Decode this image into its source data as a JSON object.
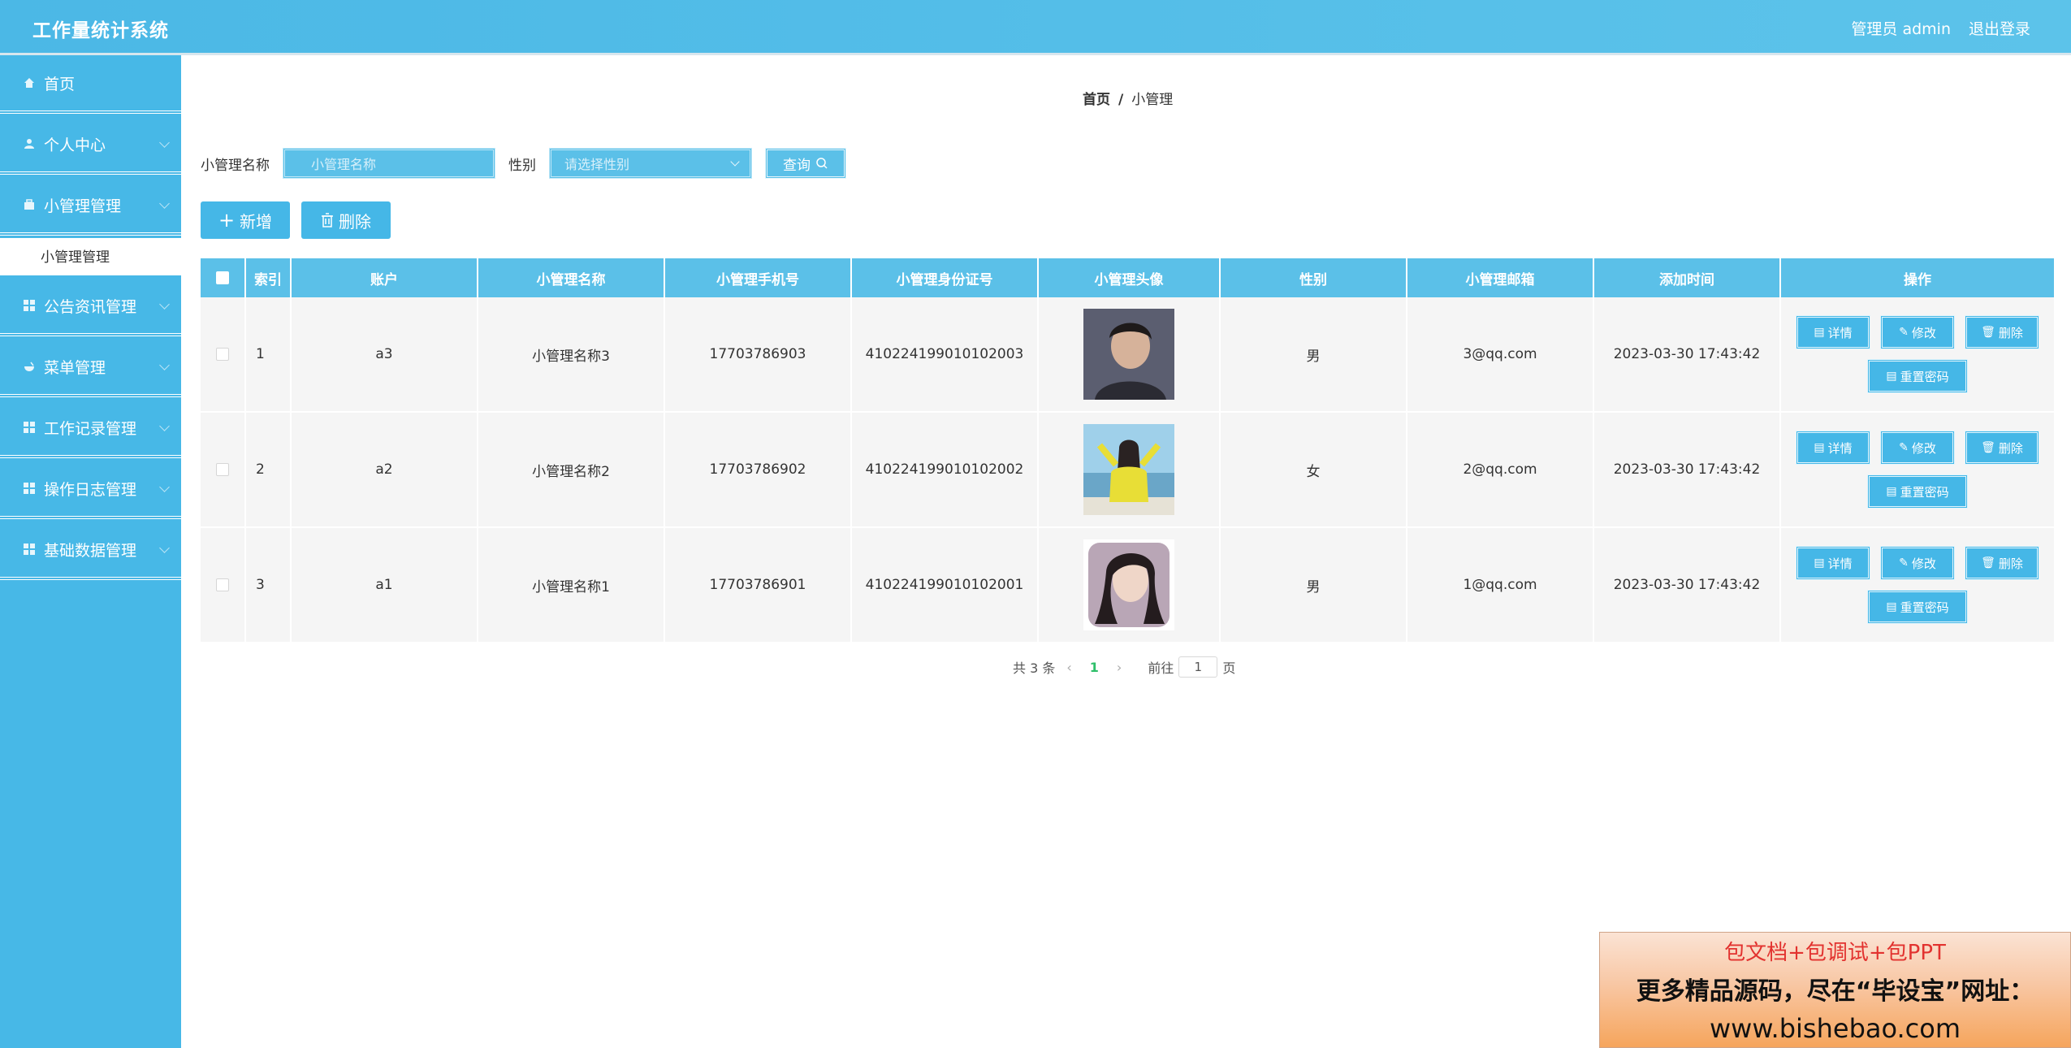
{
  "header": {
    "app_title": "工作量统计系统",
    "admin_label": "管理员 admin",
    "logout_label": "退出登录"
  },
  "sidebar": {
    "items": [
      {
        "label": "首页",
        "icon": "home-icon"
      },
      {
        "label": "个人中心",
        "icon": "user-icon"
      },
      {
        "label": "小管理管理",
        "icon": "briefcase-icon"
      },
      {
        "label": "公告资讯管理",
        "icon": "grid-icon"
      },
      {
        "label": "菜单管理",
        "icon": "bowl-icon"
      },
      {
        "label": "工作记录管理",
        "icon": "grid-icon"
      },
      {
        "label": "操作日志管理",
        "icon": "grid-icon"
      },
      {
        "label": "基础数据管理",
        "icon": "grid-icon"
      }
    ],
    "sub_item": "小管理管理"
  },
  "breadcrumb": {
    "home": "首页",
    "separator": "/",
    "current": "小管理"
  },
  "search": {
    "name_label": "小管理名称",
    "name_placeholder": "小管理名称",
    "gender_label": "性别",
    "gender_placeholder": "请选择性别",
    "query_label": "查询"
  },
  "actions": {
    "add_label": "新增",
    "delete_label": "删除"
  },
  "table": {
    "headers": [
      "索引",
      "账户",
      "小管理名称",
      "小管理手机号",
      "小管理身份证号",
      "小管理头像",
      "性别",
      "小管理邮箱",
      "添加时间",
      "操作"
    ],
    "rows": [
      {
        "index": "1",
        "account": "a3",
        "name": "小管理名称3",
        "phone": "17703786903",
        "id_card": "410224199010102003",
        "gender": "男",
        "email": "3@qq.com",
        "time": "2023-03-30 17:43:42"
      },
      {
        "index": "2",
        "account": "a2",
        "name": "小管理名称2",
        "phone": "17703786902",
        "id_card": "410224199010102002",
        "gender": "女",
        "email": "2@qq.com",
        "time": "2023-03-30 17:43:42"
      },
      {
        "index": "3",
        "account": "a1",
        "name": "小管理名称1",
        "phone": "17703786901",
        "id_card": "410224199010102001",
        "gender": "男",
        "email": "1@qq.com",
        "time": "2023-03-30 17:43:42"
      }
    ],
    "op_labels": {
      "detail": "详情",
      "edit": "修改",
      "delete": "删除",
      "reset": "重置密码"
    }
  },
  "pager": {
    "total": "共 3 条",
    "current_page": "1",
    "goto_label": "前往",
    "goto_value": "1",
    "page_suffix": "页"
  },
  "ad": {
    "line1": "包文档+包调试+包PPT",
    "line2": "更多精品源码，尽在“毕设宝”网址：",
    "line3": "www.bishebao.com"
  },
  "colors": {
    "primary": "#47b8e7",
    "table_header": "#5bc0e8",
    "pager_active": "#2ebf6a"
  }
}
